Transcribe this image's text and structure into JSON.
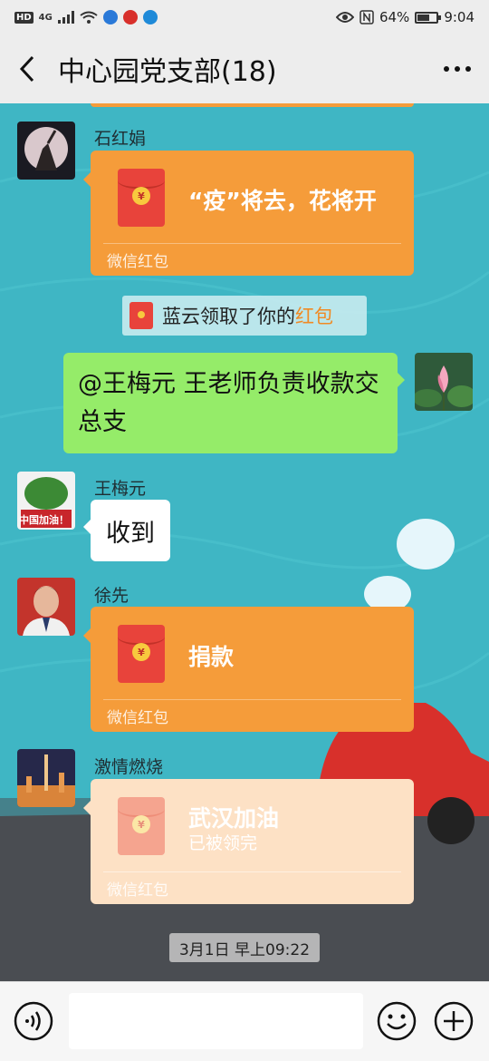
{
  "status_bar": {
    "left_badge": "HD",
    "network": "4G",
    "battery_text": "64%",
    "battery_level": 0.64,
    "time": "9:04"
  },
  "header": {
    "title": "中心园党支部(18)"
  },
  "messages": [
    {
      "type": "red_packet",
      "sender": "石红娟",
      "title": "“疫”将去，花将开",
      "subtitle": "",
      "footer": "微信红包",
      "opened": false
    },
    {
      "type": "system",
      "text_prefix": "蓝云领取了你的",
      "link_text": "红包"
    },
    {
      "type": "text_self",
      "text": "@王梅元  王老师负责收款交总支"
    },
    {
      "type": "text",
      "sender": "王梅元",
      "avatar_caption": "中国加油！",
      "text": "收到"
    },
    {
      "type": "red_packet",
      "sender": "徐先",
      "title": "捐款",
      "subtitle": "",
      "footer": "微信红包",
      "opened": false
    },
    {
      "type": "red_packet",
      "sender": "激情燃烧",
      "title": "武汉加油",
      "subtitle": "已被领完",
      "footer": "微信红包",
      "opened": true
    },
    {
      "type": "time",
      "text": "3月1日 早上09:22"
    }
  ],
  "colors": {
    "wallpaper": "#3fb6c4",
    "red_packet": "#f59c3a",
    "red_packet_opened": "#fde1c5",
    "self_bubble": "#95ec69",
    "link": "#f08a24"
  },
  "input_bar": {
    "left_icon": "voice-icon",
    "right_icons": [
      "emoji-icon",
      "plus-icon"
    ]
  }
}
